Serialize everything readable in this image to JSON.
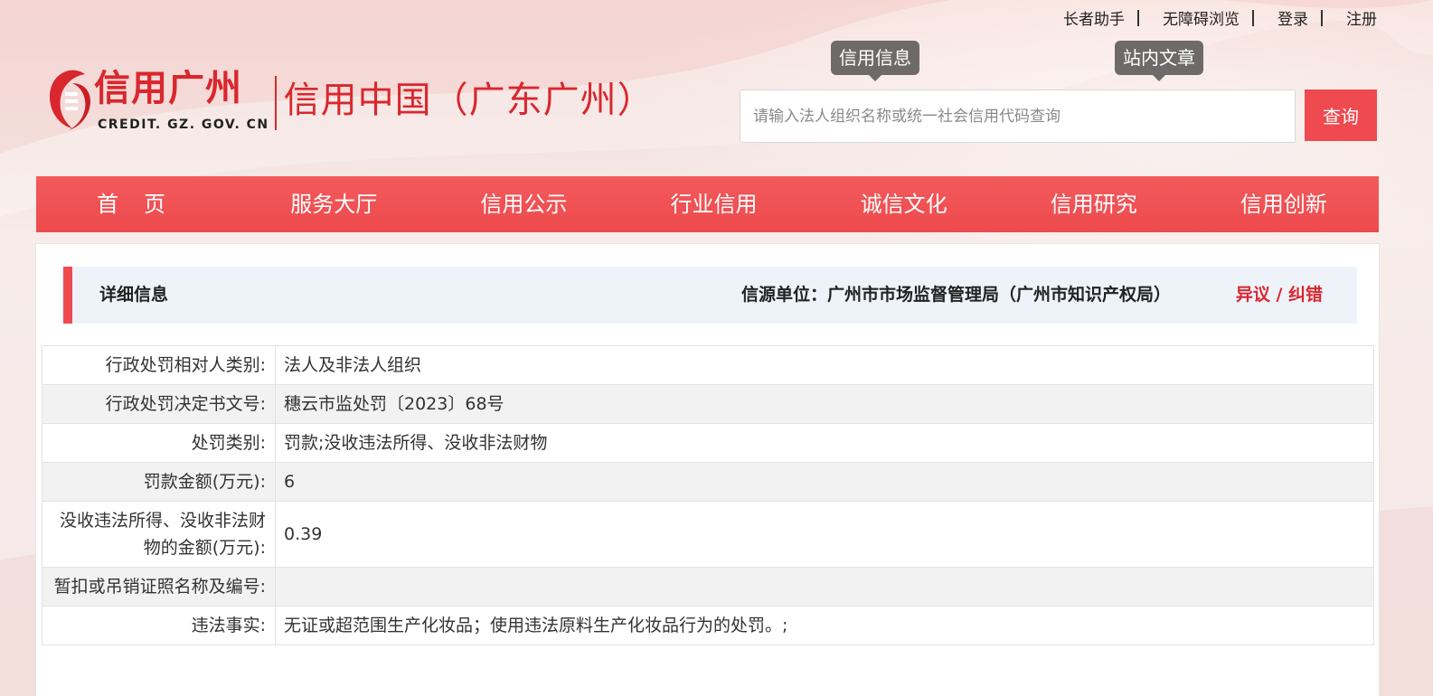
{
  "top_links": [
    {
      "label": "长者助手"
    },
    {
      "label": "无障碍浏览"
    },
    {
      "label": "登录"
    },
    {
      "label": "注册"
    }
  ],
  "logo": {
    "cn": "信用广州",
    "en": "CREDIT. GZ. GOV. CN",
    "sub": "信用中国（广东广州）"
  },
  "search": {
    "tab_credit": "信用信息",
    "tab_site": "站内文章",
    "placeholder": "请输入法人组织名称或统一社会信用代码查询",
    "button": "查询"
  },
  "nav": [
    {
      "label": "首页"
    },
    {
      "label": "服务大厅"
    },
    {
      "label": "信用公示"
    },
    {
      "label": "行业信用"
    },
    {
      "label": "诚信文化"
    },
    {
      "label": "信用研究"
    },
    {
      "label": "信用创新"
    }
  ],
  "detail": {
    "title": "详细信息",
    "source": "信源单位：广州市市场监督管理局（广州市知识产权局）",
    "objection": "异议 / 纠错"
  },
  "rows": [
    {
      "label": "行政处罚相对人类别:",
      "value": "法人及非法人组织"
    },
    {
      "label": "行政处罚决定书文号:",
      "value": "穗云市监处罚〔2023〕68号"
    },
    {
      "label": "处罚类别:",
      "value": "罚款;没收违法所得、没收非法财物"
    },
    {
      "label": "罚款金额(万元):",
      "value": "6"
    },
    {
      "label": "没收违法所得、没收非法财物的金额(万元):",
      "value": "0.39"
    },
    {
      "label": "暂扣或吊销证照名称及编号:",
      "value": ""
    },
    {
      "label": "违法事实:",
      "value": "无证或超范围生产化妆品；使用违法原料生产化妆品行为的处罚。;"
    }
  ],
  "colors": {
    "accent": "#ef4a4f",
    "brand_red": "#d9272e",
    "header_panel": "#eef3fa",
    "tab_gray": "#6e6a6a"
  }
}
